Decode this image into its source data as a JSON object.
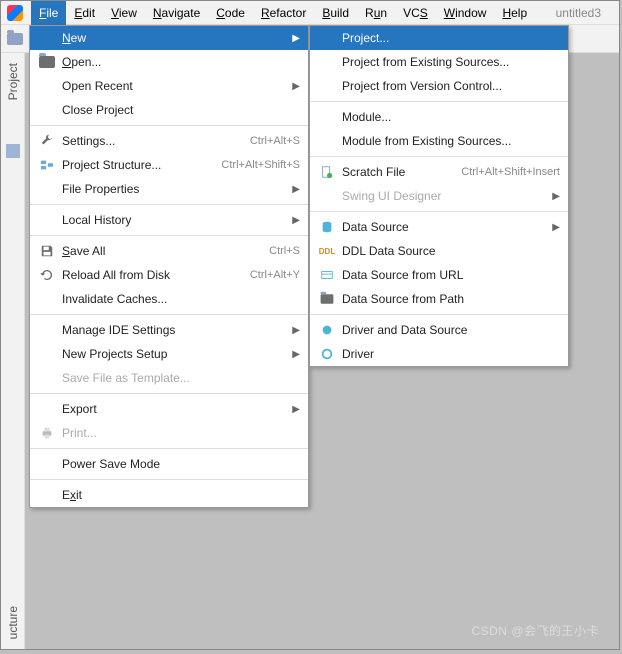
{
  "project_name": "untitled3",
  "menubar": {
    "file": "File",
    "edit": "Edit",
    "view": "View",
    "navigate": "Navigate",
    "code": "Code",
    "refactor": "Refactor",
    "build": "Build",
    "run": "Run",
    "vcs": "VCS",
    "window": "Window",
    "help": "Help"
  },
  "sidebar": {
    "project": "Project",
    "structure": "ucture"
  },
  "file_menu": {
    "new": "New",
    "open": "Open...",
    "open_recent": "Open Recent",
    "close_project": "Close Project",
    "settings": "Settings...",
    "settings_sc": "Ctrl+Alt+S",
    "project_structure": "Project Structure...",
    "project_structure_sc": "Ctrl+Alt+Shift+S",
    "file_properties": "File Properties",
    "local_history": "Local History",
    "save_all": "Save All",
    "save_all_sc": "Ctrl+S",
    "reload": "Reload All from Disk",
    "reload_sc": "Ctrl+Alt+Y",
    "invalidate": "Invalidate Caches...",
    "manage_ide": "Manage IDE Settings",
    "new_projects_setup": "New Projects Setup",
    "save_as_template": "Save File as Template...",
    "export": "Export",
    "print": "Print...",
    "power_save": "Power Save Mode",
    "exit": "Exit"
  },
  "new_menu": {
    "project": "Project...",
    "from_existing": "Project from Existing Sources...",
    "from_vcs": "Project from Version Control...",
    "module": "Module...",
    "module_existing": "Module from Existing Sources...",
    "scratch": "Scratch File",
    "scratch_sc": "Ctrl+Alt+Shift+Insert",
    "swing": "Swing UI Designer",
    "data_source": "Data Source",
    "ddl": "DDL Data Source",
    "ds_url": "Data Source from URL",
    "ds_path": "Data Source from Path",
    "driver_ds": "Driver and Data Source",
    "driver": "Driver"
  },
  "watermark": "CSDN @会飞的王小卡"
}
